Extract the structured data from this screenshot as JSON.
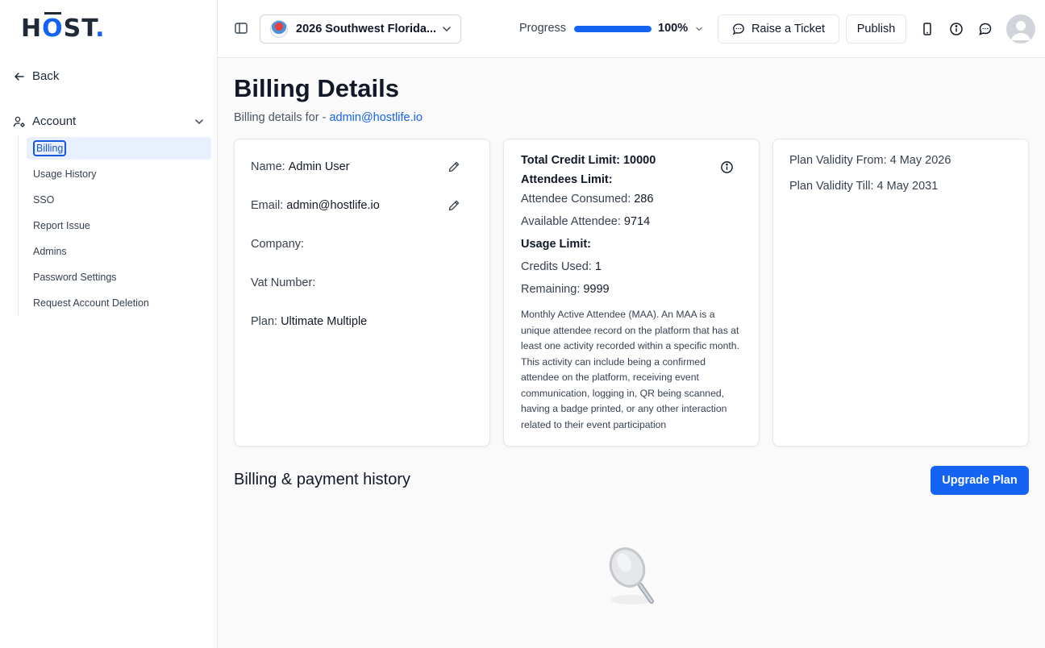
{
  "brand": {
    "logo_text_h": "H",
    "logo_text_o": "O",
    "logo_text_st": "ST",
    "logo_dot": "."
  },
  "sidebar": {
    "back_label": "Back",
    "account_label": "Account",
    "items": [
      {
        "label": "Billing",
        "active": true
      },
      {
        "label": "Usage History"
      },
      {
        "label": "SSO"
      },
      {
        "label": "Report Issue"
      },
      {
        "label": "Admins"
      },
      {
        "label": "Password Settings"
      },
      {
        "label": "Request Account Deletion"
      }
    ]
  },
  "topbar": {
    "event_name": "2026 Southwest Florida...",
    "progress_label": "Progress",
    "progress_value": 100,
    "progress_text": "100%",
    "raise_ticket_label": "Raise a Ticket",
    "publish_label": "Publish"
  },
  "page": {
    "title": "Billing Details",
    "subtitle_prefix": "Billing details for -",
    "subtitle_email": "admin@hostlife.io"
  },
  "account_card": {
    "name_label": "Name:",
    "name_value": "Admin User",
    "email_label": "Email:",
    "email_value": "admin@hostlife.io",
    "company_label": "Company:",
    "vat_label": "Vat Number:",
    "plan_label": "Plan:",
    "plan_value": "Ultimate Multiple"
  },
  "limits_card": {
    "total_credit_label": "Total Credit Limit:",
    "total_credit_value": "10000",
    "attendees_limit_label": "Attendees Limit:",
    "attendee_consumed_label": "Attendee Consumed:",
    "attendee_consumed_value": "286",
    "available_attendee_label": "Available Attendee:",
    "available_attendee_value": "9714",
    "usage_limit_label": "Usage Limit:",
    "credits_used_label": "Credits Used:",
    "credits_used_value": "1",
    "remaining_label": "Remaining:",
    "remaining_value": "9999",
    "maa_description": "Monthly Active Attendee (MAA). An MAA is a unique attendee record on the platform that has at least one activity recorded within a specific month. This activity can include being a confirmed attendee on the platform, receiving event communication, logging in, QR being scanned, having a badge printed, or any other interaction related to their event participation"
  },
  "validity_card": {
    "from_label": "Plan Validity From:",
    "from_value": "4 May 2026",
    "till_label": "Plan Validity Till:",
    "till_value": "4 May 2031"
  },
  "history": {
    "title": "Billing & payment history",
    "upgrade_label": "Upgrade Plan"
  },
  "colors": {
    "accent": "#1463f3",
    "active_bg": "#e8effd"
  }
}
